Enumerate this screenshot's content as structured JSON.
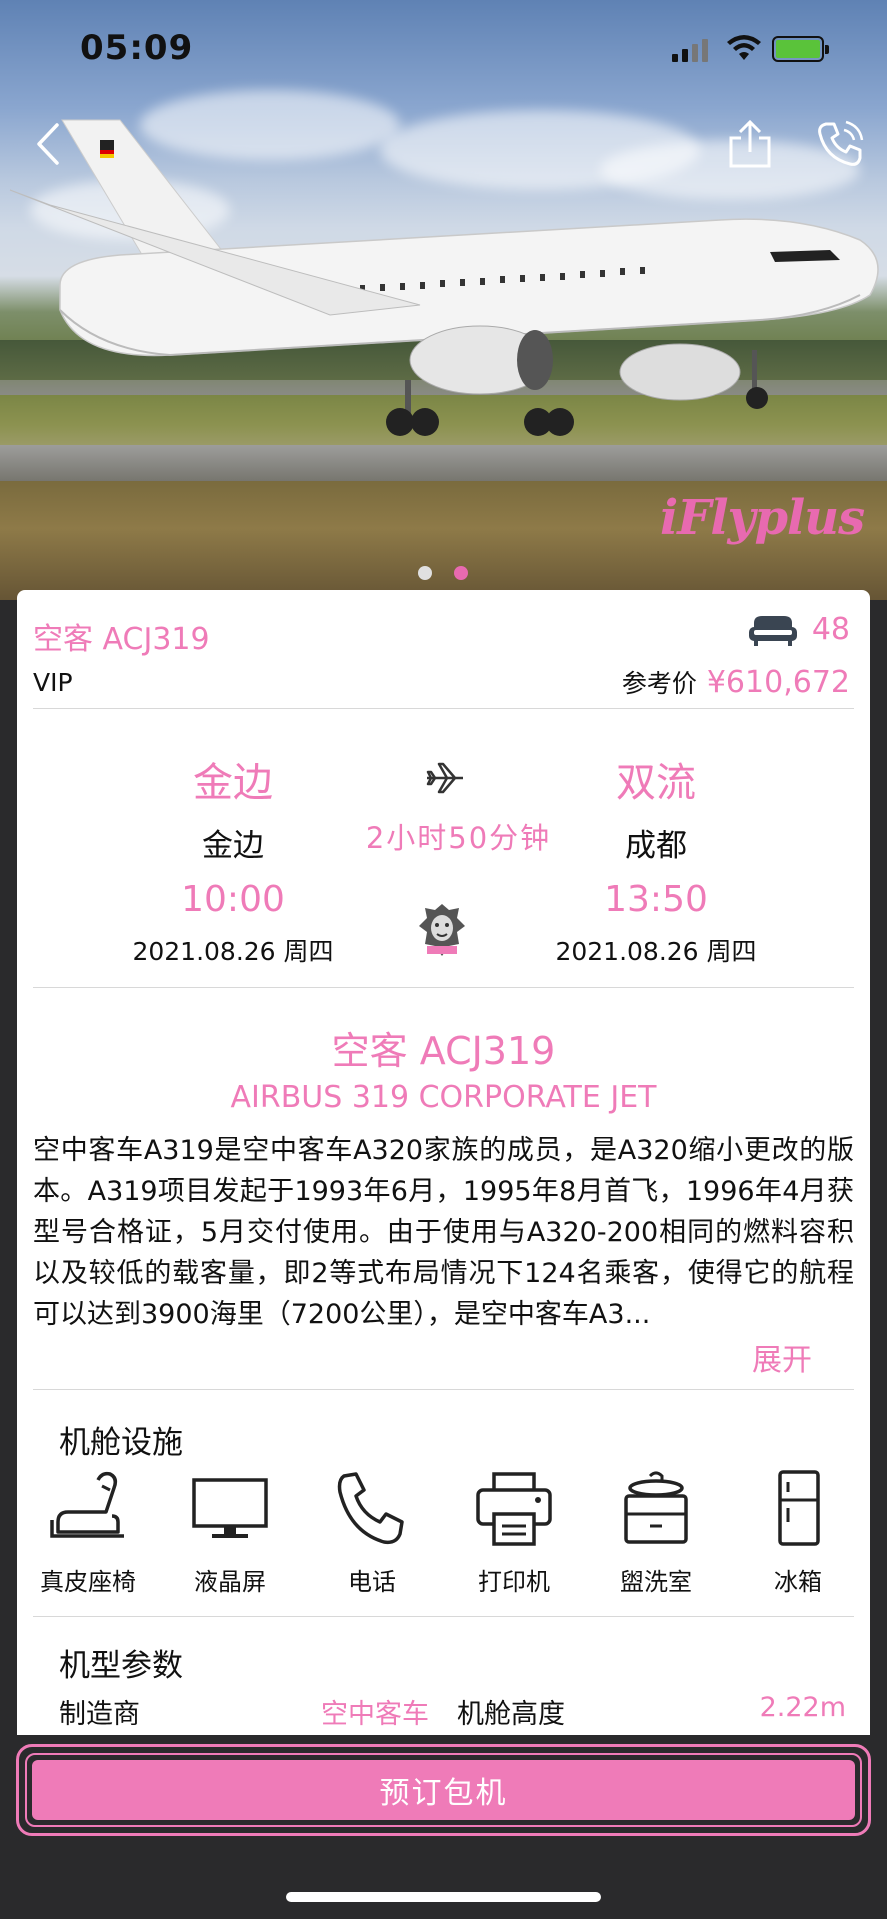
{
  "status_bar": {
    "time": "05:09"
  },
  "hero": {
    "brand_text": "iFlyplus",
    "slides": 2,
    "active_slide": 2
  },
  "flight": {
    "model": "空客 ACJ319",
    "seats": "48",
    "class": "VIP",
    "price_label": "参考价",
    "price": "¥610,672",
    "departure": {
      "airport": "金边",
      "city": "金边",
      "time": "10:00",
      "date": "2021.08.26 周四"
    },
    "arrival": {
      "airport": "双流",
      "city": "成都",
      "time": "13:50",
      "date": "2021.08.26 周四"
    },
    "duration": "2小时50分钟"
  },
  "description": {
    "title": "空客 ACJ319",
    "subtitle": "AIRBUS 319 CORPORATE JET",
    "body": "空中客车A319是空中客车A320家族的成员，是A320缩小更改的版本。A319项目发起于1993年6月，1995年8月首飞，1996年4月获型号合格证，5月交付使用。由于使用与A320-200相同的燃料容积以及较低的载客量，即2等式布局情况下124名乘客，使得它的航程可以达到3900海里（7200公里），是空中客车A3...",
    "expand_label": "展开"
  },
  "amenities": {
    "title": "机舱设施",
    "items": [
      {
        "label": "真皮座椅",
        "icon": "seat-icon"
      },
      {
        "label": "液晶屏",
        "icon": "monitor-icon"
      },
      {
        "label": "电话",
        "icon": "phone-icon"
      },
      {
        "label": "打印机",
        "icon": "printer-icon"
      },
      {
        "label": "盥洗室",
        "icon": "washroom-icon"
      },
      {
        "label": "冰箱",
        "icon": "fridge-icon"
      }
    ]
  },
  "specs": {
    "title": "机型参数",
    "items": [
      {
        "label": "制造商",
        "value": "空中客车"
      },
      {
        "label": "机舱高度",
        "value": "2.22m"
      }
    ]
  },
  "book_button": {
    "label": "预订包机"
  },
  "colors": {
    "accent": "#ef7bb8",
    "text": "#111111",
    "divider": "#d8d8d8"
  }
}
